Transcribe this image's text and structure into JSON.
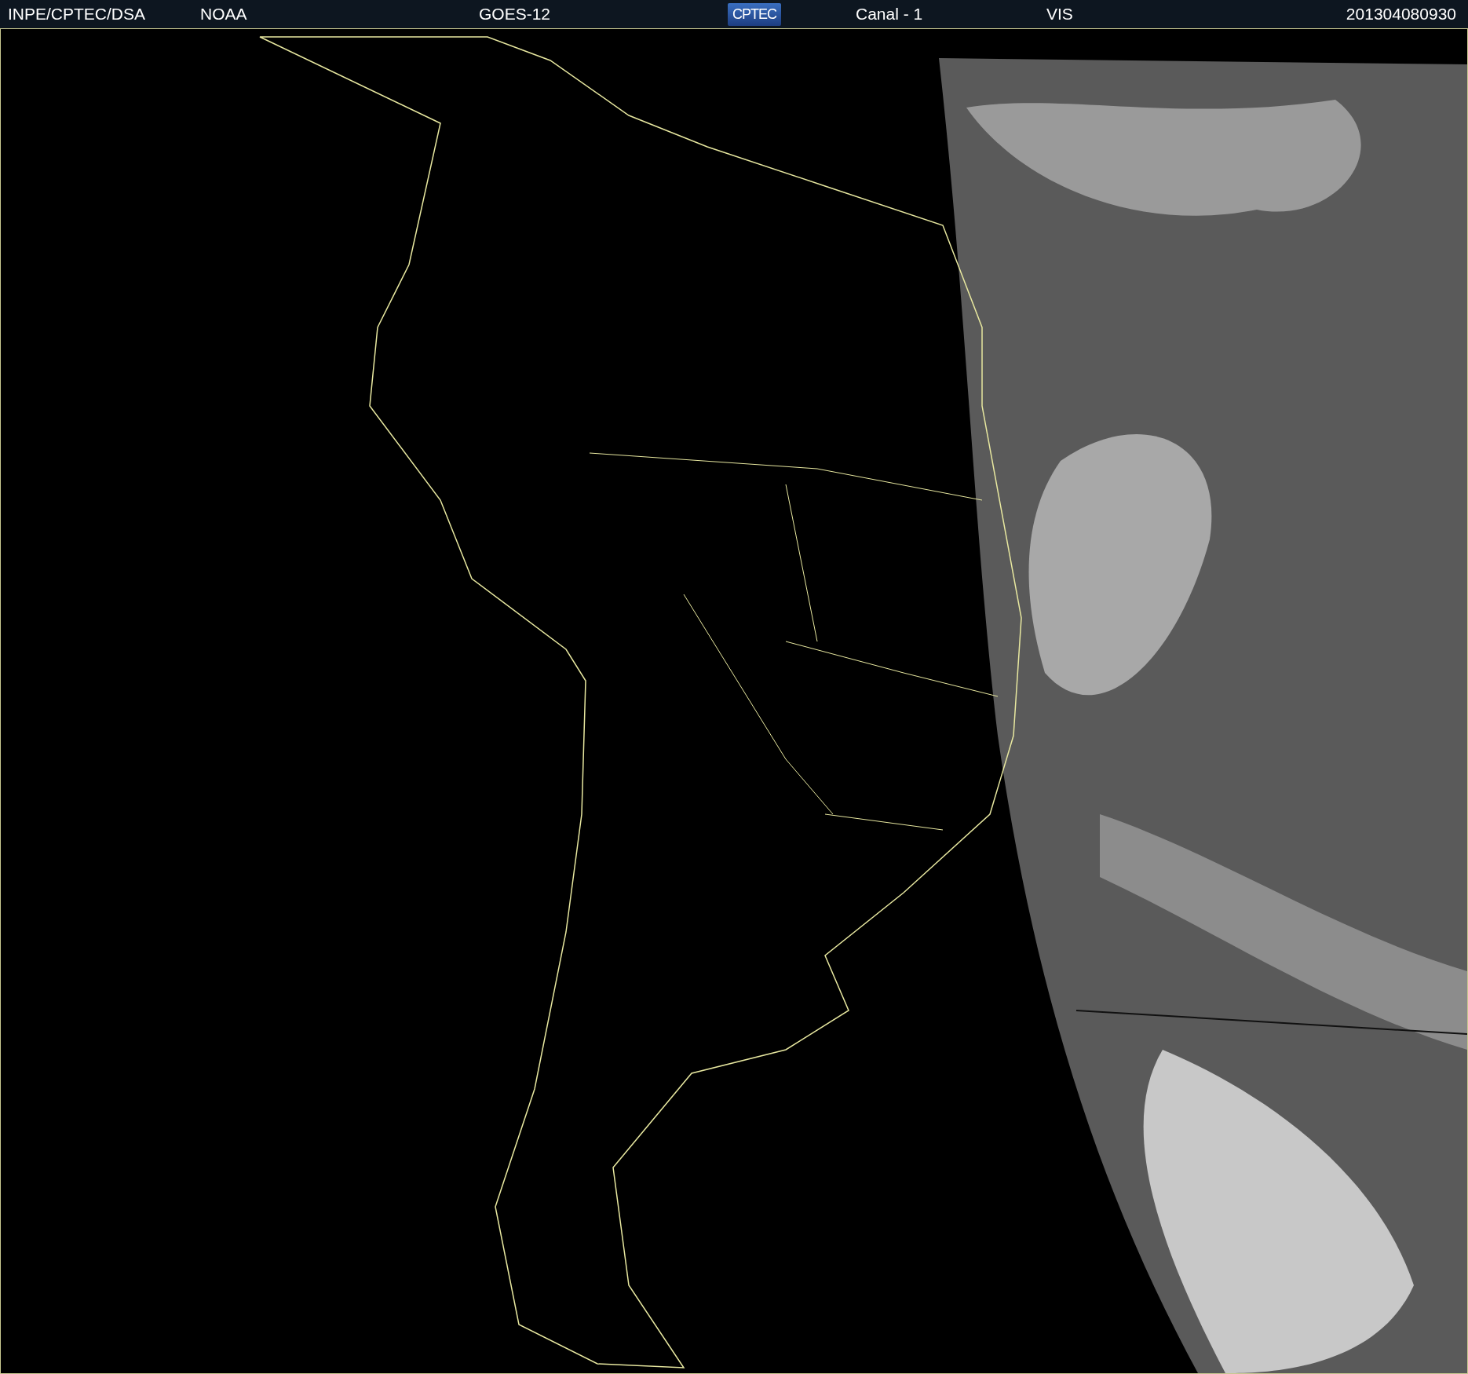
{
  "header": {
    "items": [
      {
        "kind": "text",
        "text": "INPE/CPTEC/DSA"
      },
      {
        "kind": "text",
        "text": "NOAA"
      },
      {
        "kind": "text",
        "text": "GOES-12"
      },
      {
        "kind": "logo",
        "text": "CPTEC"
      },
      {
        "kind": "text",
        "text": "Canal - 1"
      },
      {
        "kind": "text",
        "text": "VIS"
      },
      {
        "kind": "text",
        "text": "201304080930"
      }
    ]
  }
}
